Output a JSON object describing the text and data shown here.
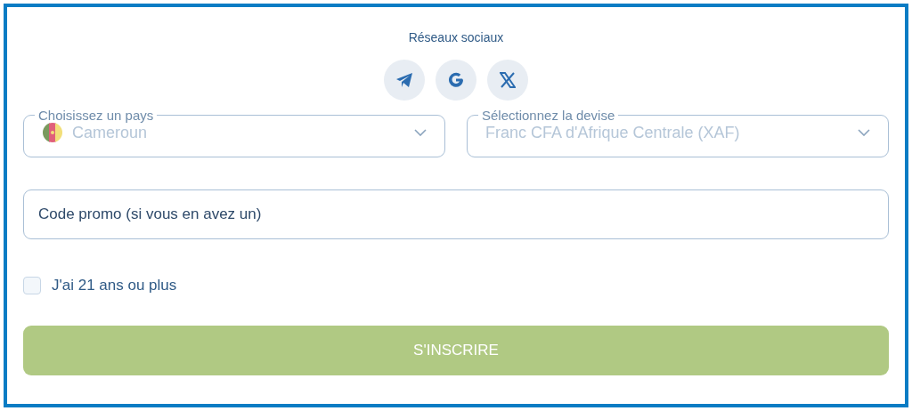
{
  "social": {
    "title": "Réseaux sociaux",
    "buttons": [
      {
        "kind": "telegram"
      },
      {
        "kind": "google"
      },
      {
        "kind": "x"
      }
    ]
  },
  "selects": [
    {
      "label": "Choisissez un pays",
      "value": "Cameroun",
      "kind": "country",
      "disabled": true
    },
    {
      "label": "Sélectionnez la devise",
      "value": "Franc CFA d'Afrique Centrale (XAF)",
      "kind": "currency",
      "disabled": true
    }
  ],
  "promo": {
    "placeholder": "Code promo (si vous en avez un)"
  },
  "age_check": {
    "label": "J'ai 21 ans ou plus",
    "checked": false
  },
  "submit": {
    "label": "S'INSCRIRE"
  }
}
